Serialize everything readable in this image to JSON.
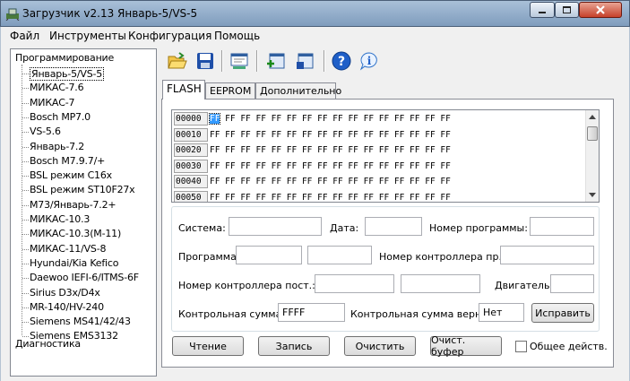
{
  "window": {
    "title": "Загрузчик v2.13 Январь-5/VS-5"
  },
  "menu": {
    "file": "Файл",
    "tools": "Инструменты",
    "config": "Конфигурация",
    "help": "Помощь"
  },
  "tree": {
    "root": "Программирование",
    "items": [
      "Январь-5/VS-5",
      "МИКАС-7.6",
      "МИКАС-7",
      "Bosch MP7.0",
      "VS-5.6",
      "Январь-7.2",
      "Bosch M7.9.7/+",
      "BSL режим C16x",
      "BSL режим ST10F27x",
      "М73/Январь-7.2+",
      "МИКАС-10.3",
      "МИКАС-10.3(М-11)",
      "МИКАС-11/VS-8",
      "Hyundai/Kia Kefico",
      "Daewoo IEFI-6/ITMS-6F",
      "Sirius D3x/D4x",
      "MR-140/HV-240",
      "Siemens MS41/42/43",
      "Siemens EMS3132"
    ],
    "last": "Диагностика"
  },
  "toolbar": {
    "icons": [
      "open-folder-icon",
      "save-icon",
      "settings-icon",
      "read-chip-icon",
      "write-chip-icon",
      "help-icon",
      "info-icon"
    ]
  },
  "tabs": {
    "flash": "FLASH",
    "eeprom": "EEPROM",
    "extra": "Дополнительно"
  },
  "hex": {
    "rows": [
      {
        "addr": "00000",
        "bytes": "FF FF FF FF FF FF FF FF FF FF FF FF FF FF FF FF"
      },
      {
        "addr": "00010",
        "bytes": "FF FF FF FF FF FF FF FF FF FF FF FF FF FF FF FF"
      },
      {
        "addr": "00020",
        "bytes": "FF FF FF FF FF FF FF FF FF FF FF FF FF FF FF FF"
      },
      {
        "addr": "00030",
        "bytes": "FF FF FF FF FF FF FF FF FF FF FF FF FF FF FF FF"
      },
      {
        "addr": "00040",
        "bytes": "FF FF FF FF FF FF FF FF FF FF FF FF FF FF FF FF"
      },
      {
        "addr": "00050",
        "bytes": "FF FF FF FF FF FF FF FF FF FF FF FF FF FF FF FF"
      }
    ]
  },
  "form": {
    "system_label": "Система:",
    "system_value": "",
    "date_label": "Дата:",
    "date_value": "",
    "prog_num_label": "Номер программы:",
    "prog_num_value": "",
    "program_label": "Программа:",
    "program_value": "",
    "program_value2": "",
    "ctrl_pr_label": "Номер контроллера пр.:",
    "ctrl_pr_value": "",
    "ctrl_post_label": "Номер контроллера пост.:",
    "ctrl_post_value": "",
    "ctrl_post_value2": "",
    "engine_label": "Двигатель:",
    "engine_value": "",
    "checksum_label": "Контрольная сумма:",
    "checksum_value": "FFFF",
    "checksum_ok_label": "Контрольная сумма верна:",
    "checksum_ok_value": "Нет",
    "fix_button": "Исправить"
  },
  "actions": {
    "read": "Чтение",
    "write": "Запись",
    "clear": "Очистить",
    "clear_buffer": "Очист. буфер",
    "common_label": "Общее действ."
  }
}
